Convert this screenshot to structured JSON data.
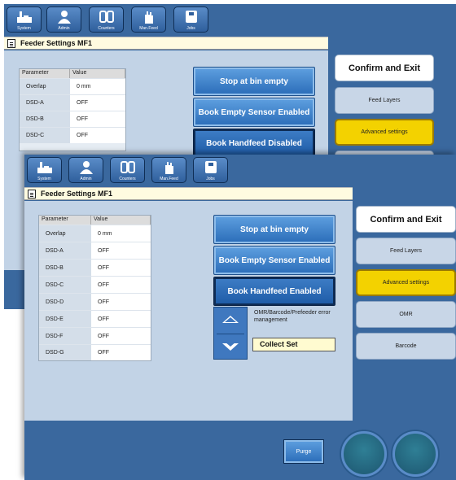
{
  "toolbar": {
    "system": "System",
    "admin": "Admin",
    "counters": "Counters",
    "man_feed": "Man.Feed",
    "jobs": "Jobs"
  },
  "title": "Feeder Settings MF1",
  "table": {
    "col_parameter": "Parameter",
    "col_value": "Value",
    "rows_back": [
      {
        "param": "Overlap",
        "value": "0 mm"
      },
      {
        "param": "DSD-A",
        "value": "OFF"
      },
      {
        "param": "DSD-B",
        "value": "OFF"
      },
      {
        "param": "DSD-C",
        "value": "OFF"
      },
      {
        "param": "DSD-D",
        "value": "OFF"
      }
    ],
    "rows": [
      {
        "param": "Overlap",
        "value": "0 mm"
      },
      {
        "param": "DSD-A",
        "value": "OFF"
      },
      {
        "param": "DSD-B",
        "value": "OFF"
      },
      {
        "param": "DSD-C",
        "value": "OFF"
      },
      {
        "param": "DSD-D",
        "value": "OFF"
      },
      {
        "param": "DSD-E",
        "value": "OFF"
      },
      {
        "param": "DSD-F",
        "value": "OFF"
      },
      {
        "param": "DSD-G",
        "value": "OFF"
      }
    ]
  },
  "back_window": {
    "stop_bin_empty": "Stop at bin empty",
    "book_empty_sensor": "Book Empty Sensor Enabled",
    "book_handfeed": "Book Handfeed Disabled"
  },
  "front_window": {
    "stop_bin_empty": "Stop at bin empty",
    "book_empty_sensor": "Book Empty Sensor Enabled",
    "book_handfeed": "Book Handfeed Enabled",
    "error_mgmt_label": "OMR/Barcode/Prefeeder error management",
    "error_mgmt_value": "Collect Set",
    "purge": "Purge"
  },
  "sidebar": {
    "confirm": "Confirm and Exit",
    "feed_layers": "Feed Layers",
    "advanced": "Advanced settings",
    "omr": "OMR",
    "barcode": "Barcode"
  },
  "colors": {
    "frame": "#3a689e",
    "panel": "#c2d3e6",
    "highlight": "#f3d200"
  }
}
